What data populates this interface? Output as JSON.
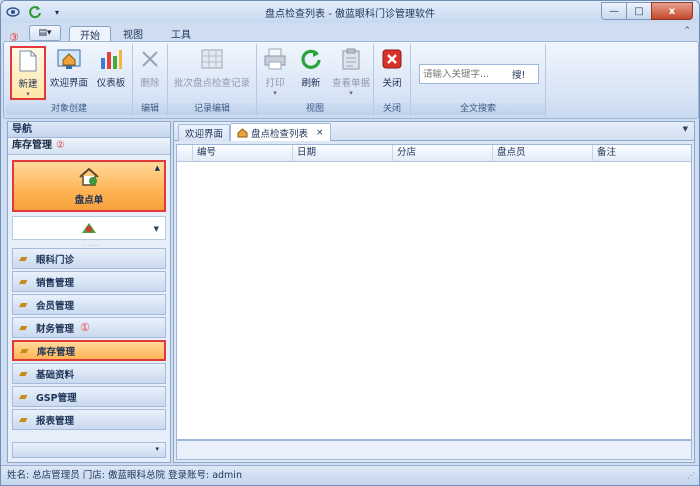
{
  "window": {
    "title": "盘点检查列表 - 傲蓝眼科门诊管理软件",
    "minimize": "—",
    "maximize": "□",
    "close": "x"
  },
  "ribbon_tabs": [
    "开始",
    "视图",
    "工具"
  ],
  "app_menu": "▤▾",
  "ribbon": {
    "groups": [
      {
        "label": "对象创建"
      },
      {
        "label": "编辑"
      },
      {
        "label": "记录编辑"
      },
      {
        "label": "视图"
      },
      {
        "label": "关闭"
      },
      {
        "label": "全文搜索"
      }
    ],
    "buttons": {
      "new": "新建",
      "welcome": "欢迎界面",
      "dashboard": "仪表板",
      "delete": "删除",
      "batch": "批次盘点检查记录",
      "print": "打印",
      "refresh": "刷新",
      "view_doc": "查看单据",
      "close": "关闭"
    },
    "search": {
      "placeholder": "请输入关键字...",
      "button": "搜!"
    },
    "marker": "③"
  },
  "nav": {
    "header": "导航",
    "section": "库存管理",
    "section_marker": "②",
    "big_item": "盘点单",
    "menu": [
      {
        "label": "眼科门诊",
        "marker": ""
      },
      {
        "label": "销售管理",
        "marker": ""
      },
      {
        "label": "会员管理",
        "marker": ""
      },
      {
        "label": "财务管理",
        "marker": "①"
      },
      {
        "label": "库存管理",
        "marker": ""
      },
      {
        "label": "基础资料",
        "marker": ""
      },
      {
        "label": "GSP管理",
        "marker": ""
      },
      {
        "label": "报表管理",
        "marker": ""
      }
    ]
  },
  "doc_tabs": {
    "welcome": "欢迎界面",
    "list": "盘点检查列表",
    "close": "×"
  },
  "grid": {
    "columns": [
      "编号",
      "日期",
      "分店",
      "盘点员",
      "备注"
    ]
  },
  "status": "姓名: 总店管理员  门店: 傲蓝眼科总院  登录账号: admin"
}
